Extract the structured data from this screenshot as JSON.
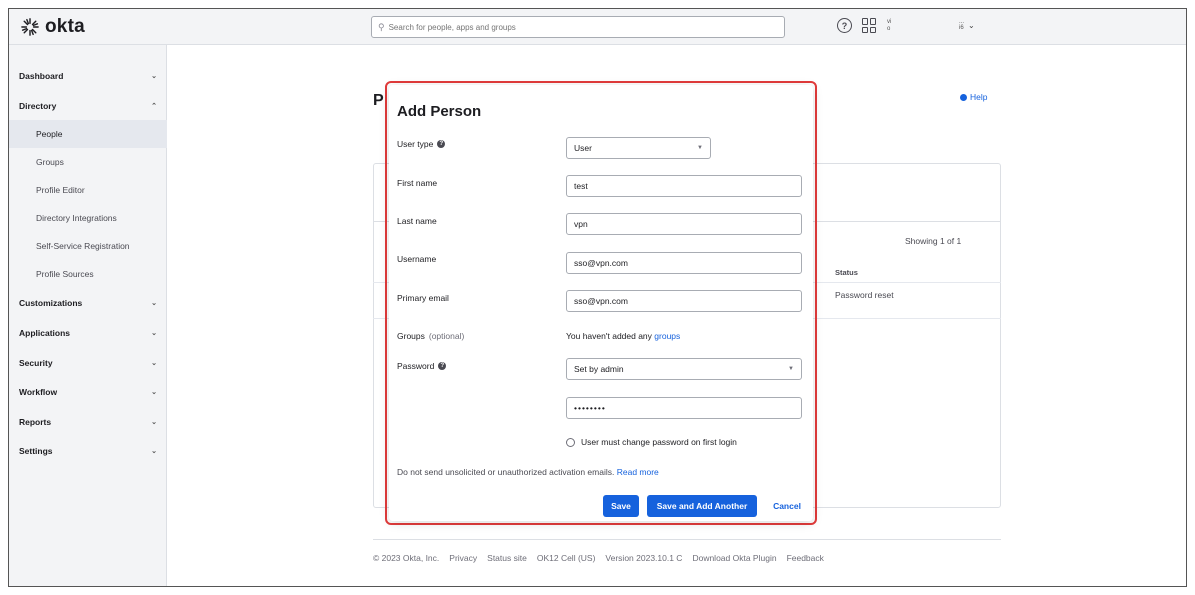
{
  "brand": {
    "logo_text": "okta"
  },
  "topbar": {
    "search_placeholder": "Search for people, apps and groups",
    "help_symbol": "?",
    "user_line1": "vi",
    "user_line2": "o",
    "org_line1": "...",
    "org_line2": "i6"
  },
  "sidebar": {
    "items": [
      {
        "label": "Dashboard",
        "chevron": "⌄"
      },
      {
        "label": "Directory",
        "chevron": "⌃"
      },
      {
        "label": "Customizations",
        "chevron": "⌄"
      },
      {
        "label": "Applications",
        "chevron": "⌄"
      },
      {
        "label": "Security",
        "chevron": "⌄"
      },
      {
        "label": "Workflow",
        "chevron": "⌄"
      },
      {
        "label": "Reports",
        "chevron": "⌄"
      },
      {
        "label": "Settings",
        "chevron": "⌄"
      }
    ],
    "directory_sub": [
      "People",
      "Groups",
      "Profile Editor",
      "Directory Integrations",
      "Self-Service Registration",
      "Profile Sources"
    ]
  },
  "page": {
    "title_initial": "P",
    "help_label": "Help",
    "showing": "Showing 1 of 1",
    "status_header": "Status",
    "status_value": "Password reset"
  },
  "footer": {
    "links": [
      "© 2023 Okta, Inc.",
      "Privacy",
      "Status site",
      "OK12 Cell (US)",
      "Version 2023.10.1 C",
      "Download Okta Plugin",
      "Feedback"
    ]
  },
  "modal": {
    "title": "Add Person",
    "fields": {
      "user_type_label": "User type",
      "user_type_value": "User",
      "first_name_label": "First name",
      "first_name_value": "test",
      "last_name_label": "Last name",
      "last_name_value": "vpn",
      "username_label": "Username",
      "username_value": "sso@vpn.com",
      "primary_email_label": "Primary email",
      "primary_email_value": "sso@vpn.com",
      "groups_label": "Groups",
      "groups_optional": "(optional)",
      "groups_text": "You haven't added any",
      "groups_link": "groups",
      "password_label": "Password",
      "password_mode": "Set by admin",
      "password_value": "••••••••",
      "change_password_label": "User must change password on first login"
    },
    "notice": "Do not send unsolicited or unauthorized activation emails.",
    "notice_link": "Read more",
    "buttons": {
      "save": "Save",
      "save_add_another": "Save and Add Another",
      "cancel": "Cancel"
    }
  },
  "colors": {
    "accent": "#1662dd",
    "highlight_outline": "#e23b3b",
    "sidebar_bg": "#f3f4f6"
  }
}
